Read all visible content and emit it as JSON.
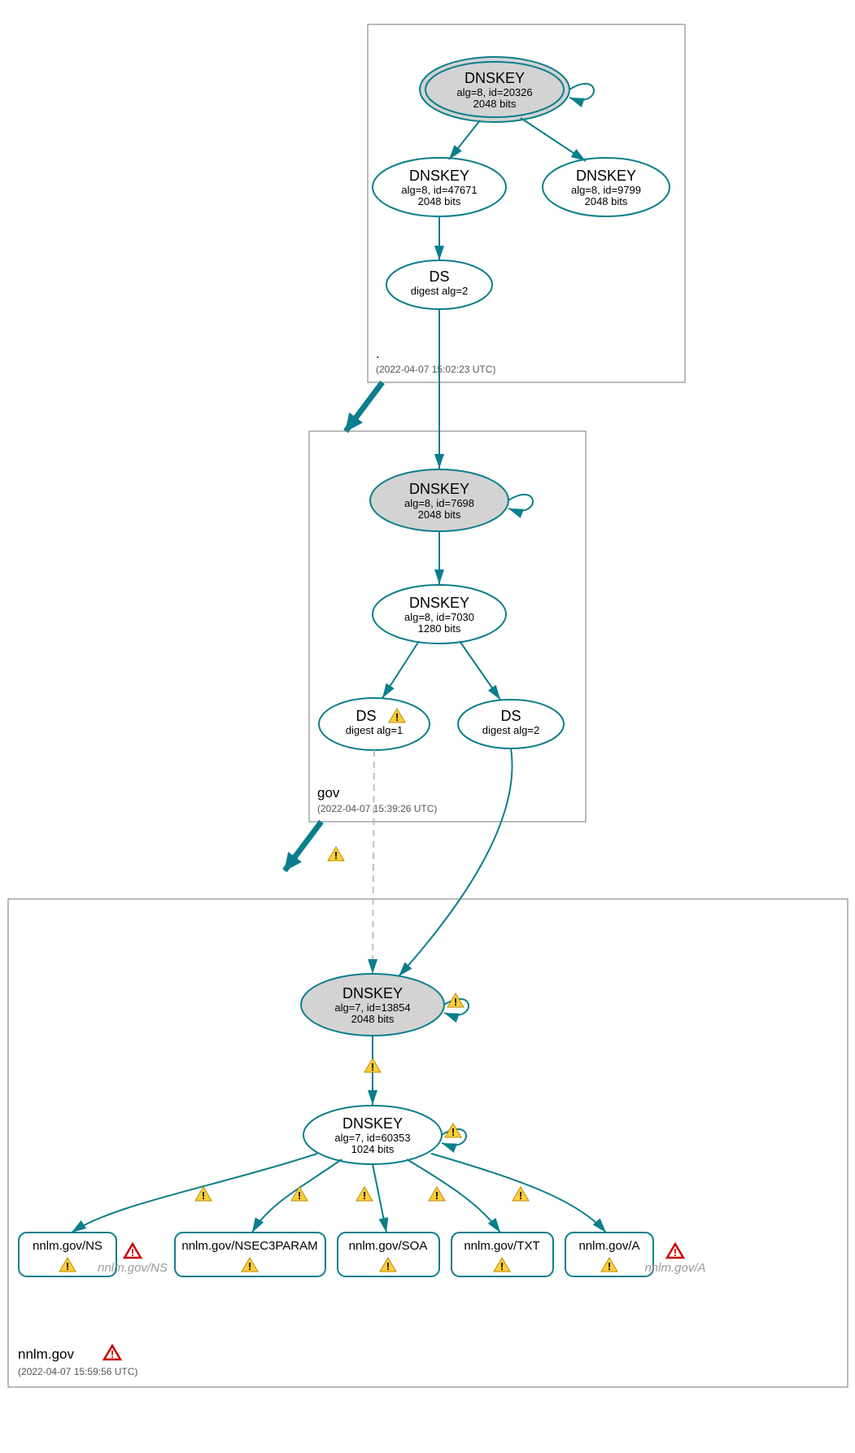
{
  "zones": {
    "root": {
      "label": ".",
      "timestamp": "(2022-04-07 15:02:23 UTC)",
      "nodes": {
        "ksk": {
          "title": "DNSKEY",
          "line1": "alg=8, id=20326",
          "line2": "2048 bits"
        },
        "zsk1": {
          "title": "DNSKEY",
          "line1": "alg=8, id=47671",
          "line2": "2048 bits"
        },
        "zsk2": {
          "title": "DNSKEY",
          "line1": "alg=8, id=9799",
          "line2": "2048 bits"
        },
        "ds": {
          "title": "DS",
          "line1": "digest alg=2"
        }
      }
    },
    "gov": {
      "label": "gov",
      "timestamp": "(2022-04-07 15:39:26 UTC)",
      "nodes": {
        "ksk": {
          "title": "DNSKEY",
          "line1": "alg=8, id=7698",
          "line2": "2048 bits"
        },
        "zsk": {
          "title": "DNSKEY",
          "line1": "alg=8, id=7030",
          "line2": "1280 bits"
        },
        "ds1": {
          "title": "DS",
          "line1": "digest alg=1"
        },
        "ds2": {
          "title": "DS",
          "line1": "digest alg=2"
        }
      }
    },
    "nnlm": {
      "label": "nnlm.gov",
      "timestamp": "(2022-04-07 15:59:56 UTC)",
      "nodes": {
        "ksk": {
          "title": "DNSKEY",
          "line1": "alg=7, id=13854",
          "line2": "2048 bits"
        },
        "zsk": {
          "title": "DNSKEY",
          "line1": "alg=7, id=60353",
          "line2": "1024 bits"
        }
      },
      "rrsets": {
        "ns": "nnlm.gov/NS",
        "n3p": "nnlm.gov/NSEC3PARAM",
        "soa": "nnlm.gov/SOA",
        "txt": "nnlm.gov/TXT",
        "a": "nnlm.gov/A"
      },
      "grey": {
        "ns": "nnlm.gov/NS",
        "a": "nnlm.gov/A"
      }
    }
  }
}
